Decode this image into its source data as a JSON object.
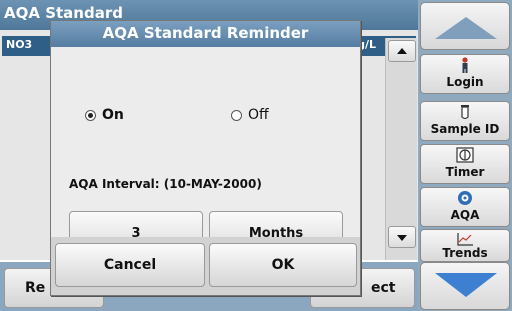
{
  "background": {
    "header_title": "AQA Standard",
    "column_left": "NO3",
    "column_right": "g/L",
    "footer_left": "Re",
    "footer_right": "ect"
  },
  "sidebar": {
    "login": {
      "label": "Login",
      "icon": "person-icon"
    },
    "sample_id": {
      "label": "Sample ID",
      "icon": "vial-icon"
    },
    "timer": {
      "label": "Timer",
      "icon": "timer-icon"
    },
    "aqa": {
      "label": "AQA",
      "icon": "aqa-icon"
    },
    "trends": {
      "label": "Trends",
      "icon": "chart-icon"
    }
  },
  "dialog": {
    "title": "AQA Standard Reminder",
    "options": [
      {
        "label": "On",
        "selected": true
      },
      {
        "label": "Off",
        "selected": false
      }
    ],
    "interval_label": "AQA Interval: (10-MAY-2000)",
    "interval_value": "3",
    "interval_unit": "Months",
    "cancel_label": "Cancel",
    "ok_label": "OK"
  },
  "colors": {
    "title_bar": "#557da2",
    "sidebar": "#8fa9bf",
    "nav_down_arrow": "#3d7fd0"
  }
}
